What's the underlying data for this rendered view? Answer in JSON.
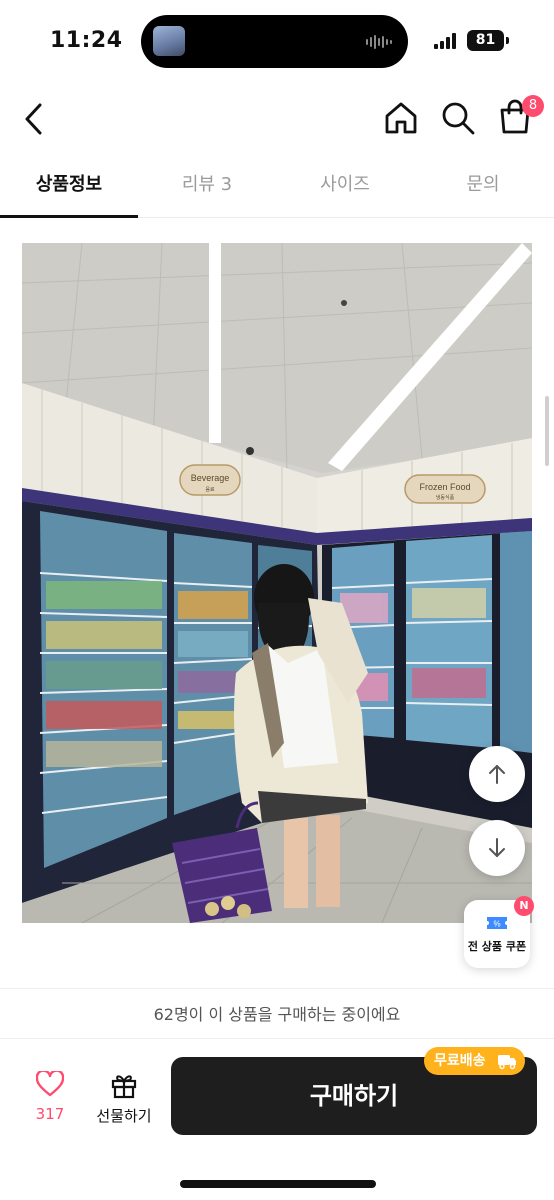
{
  "status_bar": {
    "time": "11:24",
    "battery": "81"
  },
  "header": {
    "cart_count": "8",
    "icons": [
      "back-icon",
      "home-icon",
      "search-icon",
      "cart-icon"
    ]
  },
  "tabs": [
    {
      "label": "상품정보",
      "active": true
    },
    {
      "label": "리뷰 3",
      "active": false
    },
    {
      "label": "사이즈",
      "active": false
    },
    {
      "label": "문의",
      "active": false
    }
  ],
  "photo": {
    "signs": {
      "beverage": "Beverage",
      "beverage_sub": "음료",
      "frozen": "Frozen Food",
      "frozen_sub": "냉동식품"
    }
  },
  "floating": {
    "coupon_label": "전 상품 쿠폰",
    "coupon_badge": "N"
  },
  "bottom": {
    "purchase_notice": "62명이 이 상품을 구매하는 중이에요",
    "like_count": "317",
    "gift_label": "선물하기",
    "buy_label": "구매하기",
    "shipping_badge": "무료배송"
  },
  "colors": {
    "accent_pink": "#ff4b6e",
    "shipping_orange": "#ffb21c",
    "buy_button": "#1e1e1e"
  }
}
